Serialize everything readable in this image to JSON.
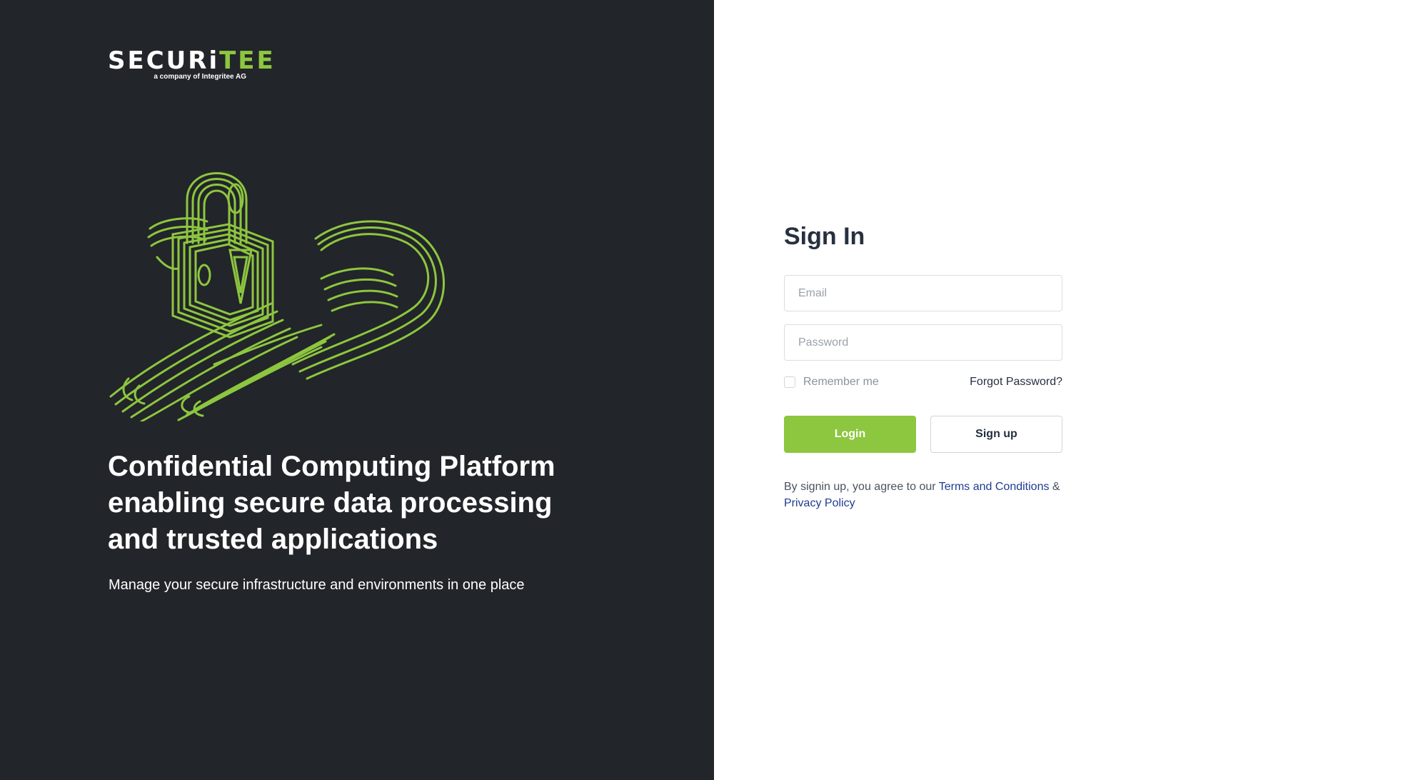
{
  "brand": {
    "name_white": "SECURi",
    "name_green": "TEE",
    "subtitle": "a company of Integritee AG",
    "accent_color": "#8dc63f",
    "panel_color": "#222529"
  },
  "hero": {
    "illustration": "padlock-on-fingerprint-hand-illustration",
    "headline": "Confidential Computing Platform enabling secure data processing and trusted applications",
    "tagline": "Manage your secure infrastructure and environments in one place"
  },
  "signin": {
    "title": "Sign In",
    "email_placeholder": "Email",
    "email_value": "",
    "password_placeholder": "Password",
    "password_value": "",
    "remember_label": "Remember me",
    "remember_checked": false,
    "forgot_label": "Forgot Password?",
    "login_label": "Login",
    "signup_label": "Sign up",
    "legal_prefix": "By signin up, you agree to our ",
    "terms_label": "Terms and Conditions",
    "legal_amp": " &",
    "privacy_label": "Privacy Policy",
    "link_color": "#1f3c8f"
  }
}
